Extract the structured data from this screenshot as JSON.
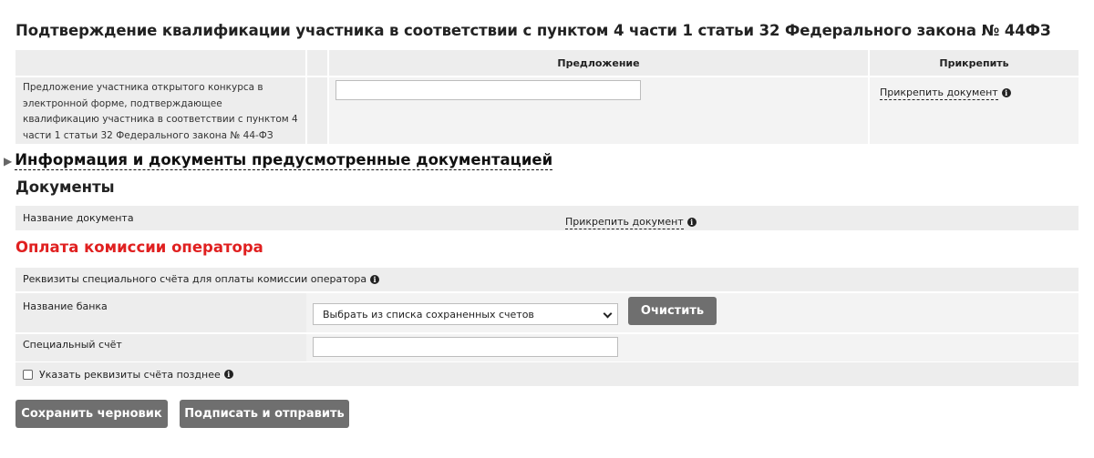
{
  "qualification": {
    "title": "Подтверждение квалификации участника в соответствии с пунктом 4 части 1 статьи 32 Федерального закона № 44ФЗ",
    "col_offer": "Предложение",
    "col_attach": "Прикрепить",
    "row_description": "Предложение участника открытого конкурса в электронной форме, подтверждающее квалификацию участника в соответствии с пунктом 4 части 1 статьи 32 Федерального закона № 44-ФЗ",
    "offer_value": "",
    "attach_link": "Прикрепить документ"
  },
  "docs_section": {
    "toggle_label": "Информация и документы предусмотренные документацией",
    "title": "Документы",
    "name_label": "Название документа",
    "attach_link": "Прикрепить документ"
  },
  "operator_fee": {
    "title": "Оплата комиссии оператора",
    "account_header": "Реквизиты специального счёта для оплаты комиссии оператора",
    "bank_label": "Название банка",
    "bank_select_value": "Выбрать из списка сохраненных счетов",
    "clear_button": "Очистить",
    "account_label": "Специальный счёт",
    "account_value": "",
    "later_checkbox_label": "Указать реквизиты счёта позднее",
    "later_checked": false,
    "accent_color": "#e02020"
  },
  "actions": {
    "save_draft": "Сохранить черновик",
    "sign_send": "Подписать и отправить"
  },
  "icons": {
    "info": "i"
  }
}
